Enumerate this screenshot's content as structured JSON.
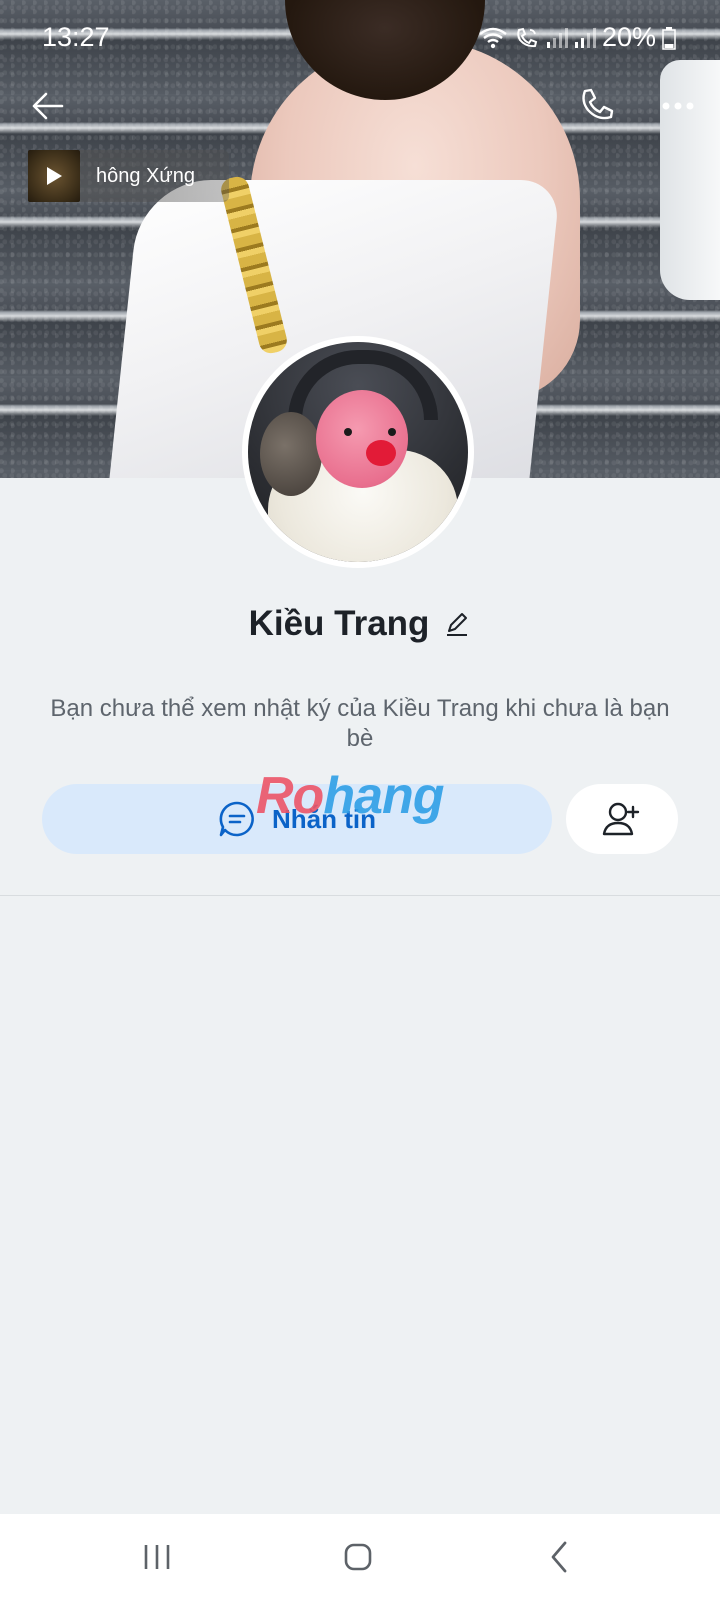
{
  "status_bar": {
    "time": "13:27",
    "battery": "20%"
  },
  "music": {
    "title": "hông Xứng"
  },
  "profile": {
    "name": "Kiều Trang",
    "notice": "Bạn chưa thể xem nhật ký của Kiều Trang khi chưa là bạn bè"
  },
  "actions": {
    "message_label": "Nhắn tin"
  },
  "watermark": {
    "part1": "Ro",
    "part2": "hang"
  },
  "colors": {
    "accent": "#0b63c8",
    "message_bg": "#d9e9fb",
    "page_bg": "#eef1f3"
  },
  "icons": {
    "back": "arrow-left-icon",
    "call": "phone-icon",
    "more": "more-dots-icon",
    "edit": "pencil-icon",
    "message": "chat-bubble-icon",
    "add_friend": "add-user-icon",
    "play": "play-icon"
  }
}
